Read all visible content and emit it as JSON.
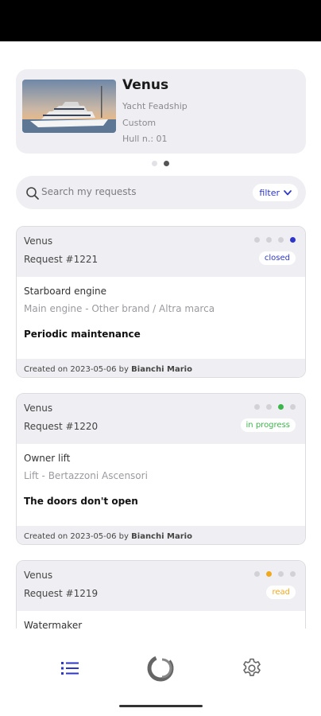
{
  "vessel": {
    "name": "Venus",
    "line1": "Yacht Feadship",
    "line2": "Custom",
    "line3": "Hull n.: 01"
  },
  "pager": {
    "total": 2,
    "active": 2
  },
  "search": {
    "placeholder": "Search my requests",
    "filter_label": "filter"
  },
  "requests": [
    {
      "vessel": "Venus",
      "number": "Request #1221",
      "status": "closed",
      "status_step": 4,
      "status_color": "#2d36c9",
      "component": "Starboard engine",
      "detail": "Main engine - Other brand / Altra marca",
      "title": "Periodic maintenance",
      "created_prefix": "Created on 2023-05-06 by ",
      "created_by": "Bianchi Mario"
    },
    {
      "vessel": "Venus",
      "number": "Request #1220",
      "status": "in progress",
      "status_step": 3,
      "status_color": "#3cb54a",
      "component": "Owner lift",
      "detail": "Lift - Bertazzoni Ascensori",
      "title": "The doors don't open",
      "created_prefix": "Created on 2023-05-06 by ",
      "created_by": "Bianchi Mario"
    },
    {
      "vessel": "Venus",
      "number": "Request #1219",
      "status": "read",
      "status_step": 2,
      "status_color": "#f0a81c",
      "component": "Watermaker",
      "detail": "",
      "title": "",
      "created_prefix": "",
      "created_by": ""
    }
  ],
  "nav": {
    "items": [
      {
        "icon": "list-icon",
        "active": true,
        "color": "#2d36c9"
      },
      {
        "icon": "logo-icon",
        "active": false,
        "color": "#666666"
      },
      {
        "icon": "gear-icon",
        "active": false,
        "color": "#666666"
      }
    ]
  }
}
